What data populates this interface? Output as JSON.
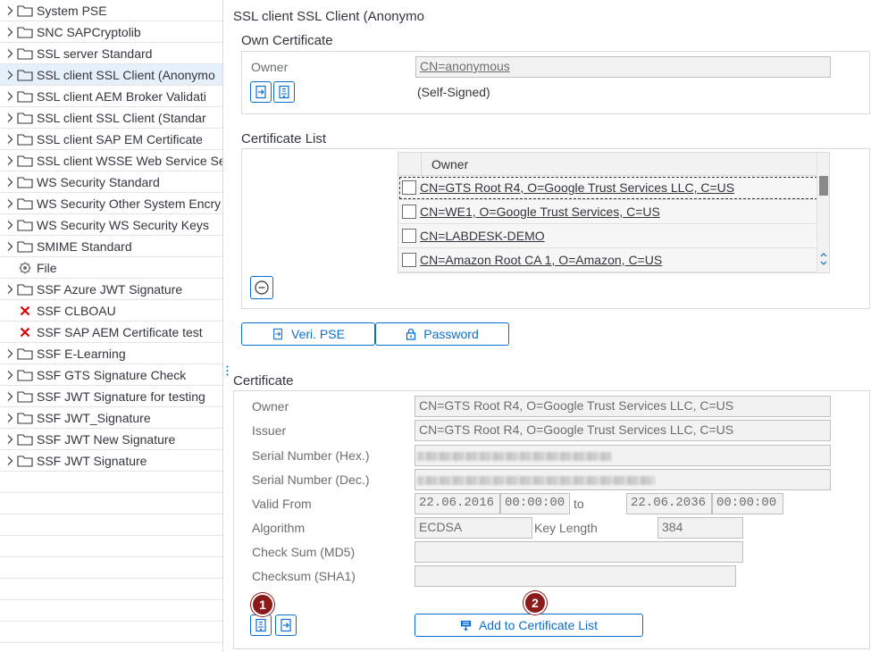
{
  "tree": {
    "items": [
      {
        "label": "System PSE",
        "type": "folder"
      },
      {
        "label": "SNC SAPCryptolib",
        "type": "folder"
      },
      {
        "label": "SSL server Standard",
        "type": "folder"
      },
      {
        "label": "SSL client SSL Client (Anonymo",
        "type": "folder",
        "selected": true
      },
      {
        "label": "SSL client AEM Broker Validati",
        "type": "folder"
      },
      {
        "label": "SSL client SSL Client (Standar",
        "type": "folder"
      },
      {
        "label": "SSL client SAP EM Certificate",
        "type": "folder"
      },
      {
        "label": "SSL client WSSE Web Service Se",
        "type": "folder"
      },
      {
        "label": "WS Security Standard",
        "type": "folder"
      },
      {
        "label": "WS Security Other System Encry",
        "type": "folder"
      },
      {
        "label": "WS Security WS Security Keys",
        "type": "folder"
      },
      {
        "label": "SMIME Standard",
        "type": "folder"
      },
      {
        "label": "File",
        "type": "file"
      },
      {
        "label": "SSF Azure JWT Signature",
        "type": "folder"
      },
      {
        "label": "SSF CLBOAU",
        "type": "error"
      },
      {
        "label": "SSF SAP AEM Certificate test",
        "type": "error"
      },
      {
        "label": "SSF E-Learning",
        "type": "folder"
      },
      {
        "label": "SSF GTS Signature Check",
        "type": "folder"
      },
      {
        "label": "SSF JWT Signature for testing",
        "type": "folder"
      },
      {
        "label": "SSF JWT_Signature",
        "type": "folder"
      },
      {
        "label": "SSF JWT New Signature",
        "type": "folder"
      },
      {
        "label": "SSF JWT Signature",
        "type": "folder"
      }
    ]
  },
  "main": {
    "title": "SSL client SSL Client (Anonymo",
    "own_cert": {
      "heading": "Own Certificate",
      "owner_label": "Owner",
      "owner_value": "CN=anonymous",
      "self_signed": "(Self-Signed)"
    },
    "cert_list": {
      "heading": "Certificate List",
      "column": "Owner",
      "rows": [
        "CN=GTS Root R4, O=Google Trust Services LLC, C=US",
        "CN=WE1, O=Google Trust Services, C=US",
        "CN=LABDESK-DEMO",
        "CN=Amazon Root CA 1, O=Amazon, C=US"
      ]
    },
    "buttons": {
      "veri_pse": "Veri. PSE",
      "password": "Password",
      "add_to_list": "Add to Certificate List"
    },
    "certificate": {
      "heading": "Certificate",
      "owner_label": "Owner",
      "owner_value": "CN=GTS Root R4, O=Google Trust Services LLC, C=US",
      "issuer_label": "Issuer",
      "issuer_value": "CN=GTS Root R4, O=Google Trust Services LLC, C=US",
      "serial_hex_label": "Serial Number (Hex.)",
      "serial_dec_label": "Serial Number (Dec.)",
      "valid_from_label": "Valid From",
      "valid_from_date": "22.06.2016",
      "valid_from_time": "00:00:00",
      "to_label": "to",
      "valid_to_date": "22.06.2036",
      "valid_to_time": "00:00:00",
      "algorithm_label": "Algorithm",
      "algorithm_value": "ECDSA",
      "key_length_label": "Key Length",
      "key_length_value": "384",
      "md5_label": "Check Sum (MD5)",
      "sha1_label": "Checksum (SHA1)"
    },
    "badges": {
      "one": "1",
      "two": "2"
    }
  },
  "colors": {
    "accent": "#0a6ed1",
    "badge": "#8b1a1a",
    "error": "#e00000"
  }
}
